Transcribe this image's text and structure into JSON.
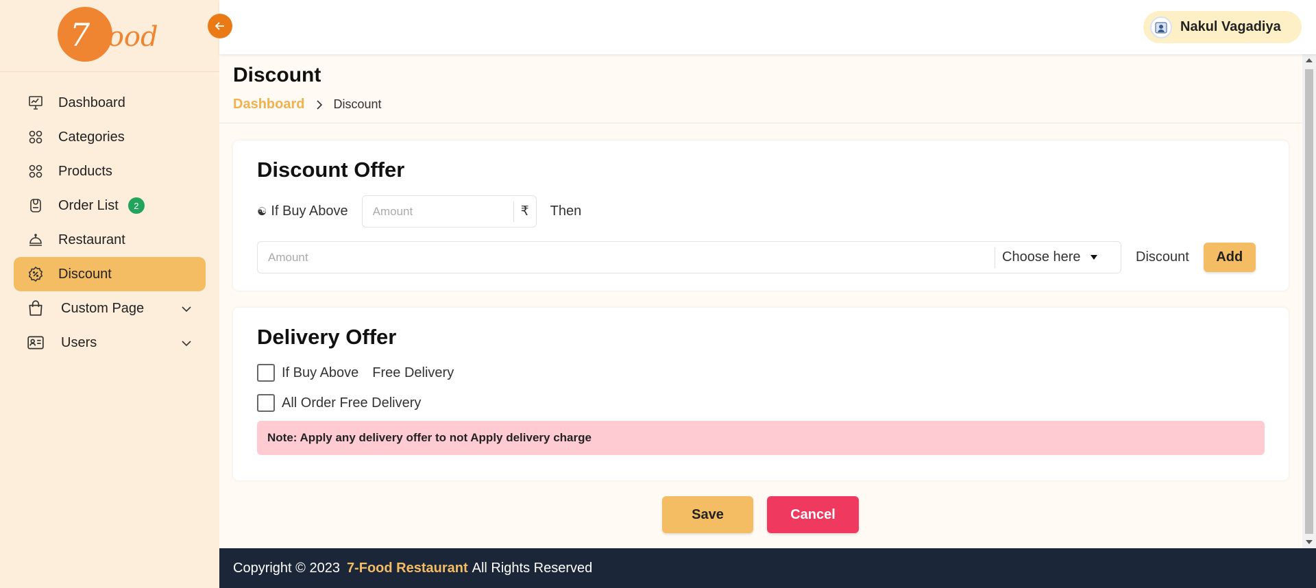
{
  "brand": {
    "logo_text": "7",
    "logo_rest": "Food"
  },
  "user": {
    "name": "Nakul Vagadiya"
  },
  "sidebar": {
    "items": [
      {
        "label": "Dashboard",
        "icon": "presentation-chart-icon"
      },
      {
        "label": "Categories",
        "icon": "grid-icon"
      },
      {
        "label": "Products",
        "icon": "grid-icon"
      },
      {
        "label": "Order List",
        "icon": "order-bag-icon",
        "badge": "2"
      },
      {
        "label": "Restaurant",
        "icon": "cloche-icon"
      },
      {
        "label": "Discount",
        "icon": "discount-badge-icon",
        "active": true
      },
      {
        "label": "Custom Page",
        "icon": "shopping-bag-icon",
        "expandable": true
      },
      {
        "label": "Users",
        "icon": "id-card-icon",
        "expandable": true
      }
    ]
  },
  "page": {
    "title": "Discount",
    "breadcrumb": {
      "link": "Dashboard",
      "current": "Discount"
    }
  },
  "discount_offer": {
    "title": "Discount Offer",
    "radio_label": "If Buy Above",
    "amount_placeholder": "Amount",
    "currency_symbol": "₹",
    "then_label": "Then",
    "discount_amount_placeholder": "Amount",
    "select_placeholder": "Choose here",
    "discount_label": "Discount",
    "add_label": "Add"
  },
  "delivery_offer": {
    "title": "Delivery Offer",
    "option1_label": "If Buy Above",
    "option1_suffix": "Free Delivery",
    "option2_label": "All Order Free Delivery",
    "note": "Note: Apply any delivery offer to not Apply delivery charge"
  },
  "actions": {
    "save_label": "Save",
    "cancel_label": "Cancel"
  },
  "footer": {
    "prefix": "Copyright © 2023",
    "brand": "7-Food Restaurant",
    "suffix": "All Rights Reserved"
  },
  "colors": {
    "accent": "#f5bd63",
    "sidebar_bg": "#fdeedb",
    "danger": "#f0395f",
    "footer_bg": "#1c2639",
    "badge": "#22a45d",
    "note_bg": "#ffcbd3"
  }
}
